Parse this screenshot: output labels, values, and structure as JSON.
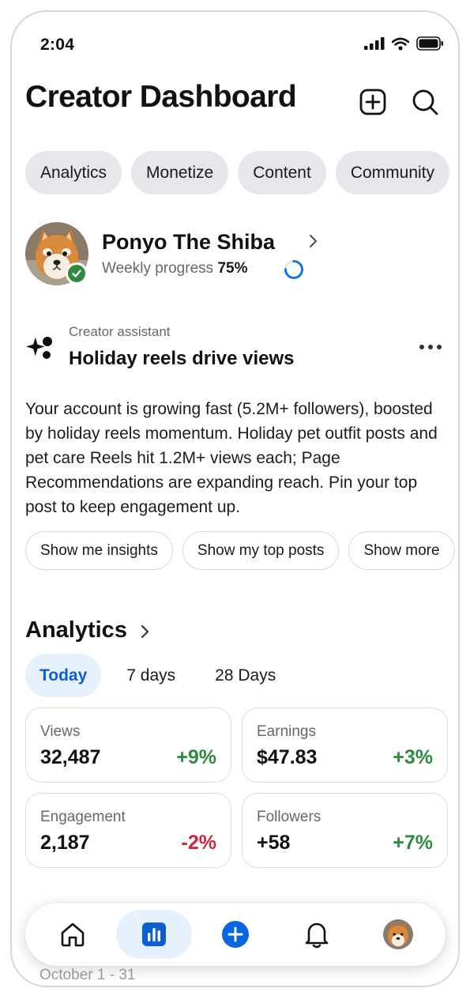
{
  "status_bar": {
    "time": "2:04"
  },
  "header": {
    "title": "Creator Dashboard",
    "add_icon": "plus-square-icon",
    "search_icon": "search-icon"
  },
  "top_tabs": [
    "Analytics",
    "Monetize",
    "Content",
    "Community"
  ],
  "profile": {
    "name": "Ponyo The Shiba",
    "progress_label": "Weekly progress",
    "progress_value": "75%",
    "progress_fraction": 0.75,
    "verified": true
  },
  "assistant": {
    "label": "Creator assistant",
    "title": "Holiday reels drive views",
    "more_icon": "more-horizontal-icon",
    "body": "Your account is growing fast (5.2M+ followers), boosted by holiday reels momentum. Holiday pet outfit posts and pet care Reels hit 1.2M+ views each; Page Recommendations are expanding reach. Pin your top post to keep engagement up."
  },
  "suggestions": [
    "Show me insights",
    "Show my top posts",
    "Show more"
  ],
  "analytics": {
    "title": "Analytics",
    "ranges": [
      "Today",
      "7 days",
      "28 Days"
    ],
    "selected_range": "Today",
    "stats": [
      {
        "label": "Views",
        "value": "32,487",
        "delta": "+9%",
        "trend": "up"
      },
      {
        "label": "Earnings",
        "value": "$47.83",
        "delta": "+3%",
        "trend": "up"
      },
      {
        "label": "Engagement",
        "value": "2,187",
        "delta": "-2%",
        "trend": "down"
      },
      {
        "label": "Followers",
        "value": "+58",
        "delta": "+7%",
        "trend": "up"
      }
    ]
  },
  "next_section": {
    "range": "October 1 - 31"
  },
  "bottom_nav": {
    "items": [
      {
        "name": "home",
        "icon": "home-icon",
        "active": false
      },
      {
        "name": "insights",
        "icon": "bar-chart-icon",
        "active": true
      },
      {
        "name": "create",
        "icon": "plus-circle-icon",
        "active": false
      },
      {
        "name": "notifications",
        "icon": "bell-icon",
        "active": false
      },
      {
        "name": "profile",
        "icon": "avatar-icon",
        "active": false
      }
    ]
  },
  "colors": {
    "accent": "#0a60d0",
    "accent_light": "#e7f1fd",
    "positive": "#2e8a3f",
    "negative": "#d0263b",
    "chip_bg": "#e6e7ea"
  }
}
